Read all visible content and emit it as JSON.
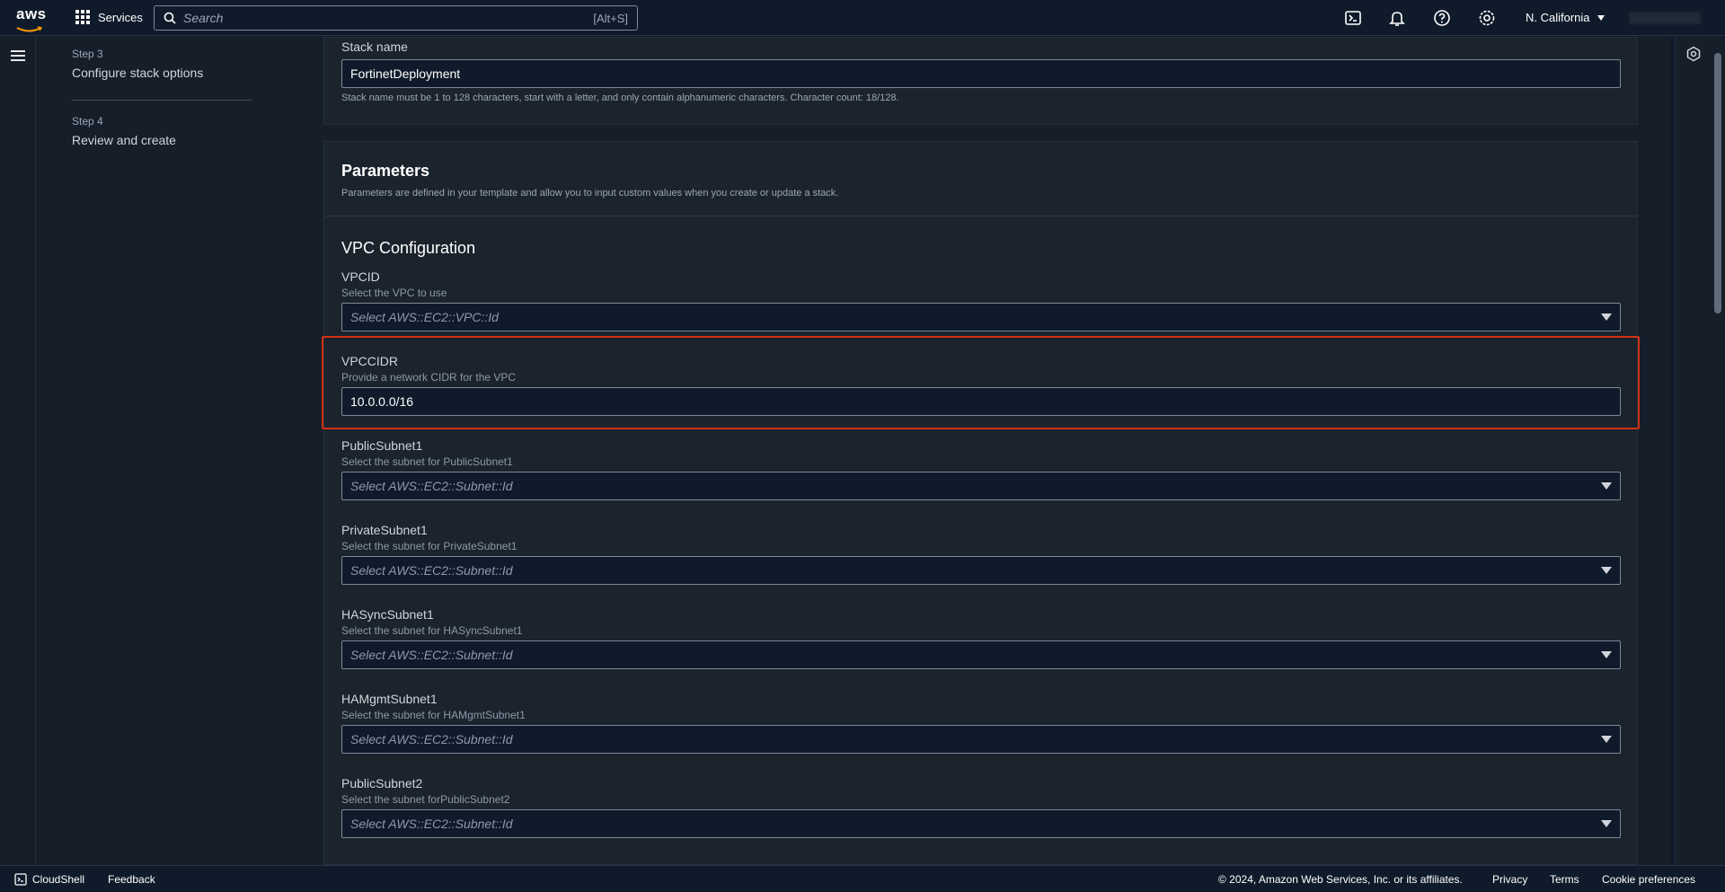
{
  "topnav": {
    "logo_text": "aws",
    "services_label": "Services",
    "search_placeholder": "Search",
    "search_shortcut": "[Alt+S]",
    "region_label": "N. California",
    "icons": [
      "cloudshell-icon",
      "bell-icon",
      "help-icon",
      "settings-icon"
    ]
  },
  "steps": [
    {
      "num": "Step 3",
      "title": "Configure stack options"
    },
    {
      "num": "Step 4",
      "title": "Review and create"
    }
  ],
  "stack": {
    "label": "Stack name",
    "value": "FortinetDeployment",
    "hint": "Stack name must be 1 to 128 characters, start with a letter, and only contain alphanumeric characters. Character count: 18/128."
  },
  "parameters": {
    "title": "Parameters",
    "description": "Parameters are defined in your template and allow you to input custom values when you create or update a stack.",
    "section_title": "VPC Configuration",
    "items": [
      {
        "label": "VPCID",
        "desc": "Select the VPC to use",
        "type": "select",
        "placeholder": "Select AWS::EC2::VPC::Id"
      },
      {
        "label": "VPCCIDR",
        "desc": "Provide a network CIDR for the VPC",
        "type": "text",
        "value": "10.0.0.0/16"
      },
      {
        "label": "PublicSubnet1",
        "desc": "Select the subnet for PublicSubnet1",
        "type": "select",
        "placeholder": "Select AWS::EC2::Subnet::Id"
      },
      {
        "label": "PrivateSubnet1",
        "desc": "Select the subnet for PrivateSubnet1",
        "type": "select",
        "placeholder": "Select AWS::EC2::Subnet::Id"
      },
      {
        "label": "HASyncSubnet1",
        "desc": "Select the subnet for HASyncSubnet1",
        "type": "select",
        "placeholder": "Select AWS::EC2::Subnet::Id"
      },
      {
        "label": "HAMgmtSubnet1",
        "desc": "Select the subnet for HAMgmtSubnet1",
        "type": "select",
        "placeholder": "Select AWS::EC2::Subnet::Id"
      },
      {
        "label": "PublicSubnet2",
        "desc": "Select the subnet forPublicSubnet2",
        "type": "select",
        "placeholder": "Select AWS::EC2::Subnet::Id"
      }
    ]
  },
  "footer": {
    "cloudshell": "CloudShell",
    "feedback": "Feedback",
    "copyright": "© 2024, Amazon Web Services, Inc. or its affiliates.",
    "privacy": "Privacy",
    "terms": "Terms",
    "cookies": "Cookie preferences"
  },
  "colors": {
    "accent_highlight": "#d13212",
    "bg": "#0f1b2a",
    "panel": "#1b232d"
  }
}
